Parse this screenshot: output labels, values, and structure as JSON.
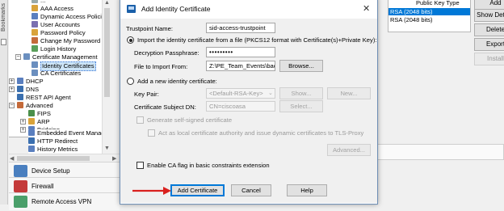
{
  "left_strip": {
    "label": "Bookmarks"
  },
  "tree": {
    "items": [
      {
        "label": "AAA Access",
        "color": "#d9a33a"
      },
      {
        "label": "Dynamic Access Policies",
        "color": "#5a7fbf"
      },
      {
        "label": "User Accounts",
        "color": "#7a6fb0"
      },
      {
        "label": "Password Policy",
        "color": "#d9a33a"
      },
      {
        "label": "Change My Password",
        "color": "#c46a3a"
      },
      {
        "label": "Login History",
        "color": "#5a9f5a"
      },
      {
        "label": "Certificate Management",
        "color": "#6b8fbf"
      },
      {
        "label": "Identity Certificates",
        "color": "#6b8fbf"
      },
      {
        "label": "CA Certificates",
        "color": "#6b8fbf"
      },
      {
        "label": "DHCP",
        "color": "#5a7fbf"
      },
      {
        "label": "DNS",
        "color": "#3a6faf"
      },
      {
        "label": "REST API Agent",
        "color": "#3a6faf"
      },
      {
        "label": "Advanced",
        "color": "#c46a3a"
      },
      {
        "label": "FIPS",
        "color": "#4a8f4a"
      },
      {
        "label": "ARP",
        "color": "#d9a33a"
      },
      {
        "label": "Bridging",
        "color": "#5a7fbf"
      },
      {
        "label": "Embedded Event Manage",
        "color": "#5a7fbf"
      },
      {
        "label": "HTTP Redirect",
        "color": "#3a6faf"
      },
      {
        "label": "History Metrics",
        "color": "#5a7fbf"
      }
    ]
  },
  "nav": {
    "items": [
      {
        "label": "Device Setup",
        "color": "#4a7fbf"
      },
      {
        "label": "Firewall",
        "color": "#c43a3a"
      },
      {
        "label": "Remote Access VPN",
        "color": "#4a9f6a"
      }
    ]
  },
  "bg_panel": {
    "column_header": "Public Key Type",
    "rows": [
      "RSA (2048 bits)",
      "RSA (2048 bits)"
    ],
    "buttons": {
      "add": "Add",
      "show_details": "Show Details",
      "delete": "Delete",
      "export": "Export",
      "install": "Install"
    }
  },
  "dialog": {
    "title": "Add Identity Certificate",
    "close": "✕",
    "trustpoint_label": "Trustpoint Name:",
    "trustpoint_value": "sid-access-trustpoint",
    "import_radio_label": "Import the identity certificate from a file (PKCS12 format with Certificate(s)+Private Key):",
    "passphrase_label": "Decryption Passphrase:",
    "passphrase_value": "•••••••••",
    "file_label": "File to Import From:",
    "file_value": "Z:\\PE_Team_Events\\backup\\PW-",
    "browse": "Browse...",
    "add_new_radio_label": "Add a new identity certificate:",
    "key_pair_label": "Key Pair:",
    "key_pair_value": "<Default-RSA-Key>",
    "show": "Show...",
    "new": "New...",
    "subject_dn_label": "Certificate Subject DN:",
    "subject_dn_value": "CN=ciscoasa",
    "select": "Select...",
    "self_signed_label": "Generate self-signed certificate",
    "local_ca_label": "Act as local certificate authority and issue dynamic certificates to TLS-Proxy",
    "advanced": "Advanced...",
    "ca_flag_label": "Enable CA flag in basic constraints extension",
    "add_certificate": "Add Certificate",
    "cancel": "Cancel",
    "help": "Help"
  },
  "annotation": {
    "arrow_color": "#d9201e"
  }
}
